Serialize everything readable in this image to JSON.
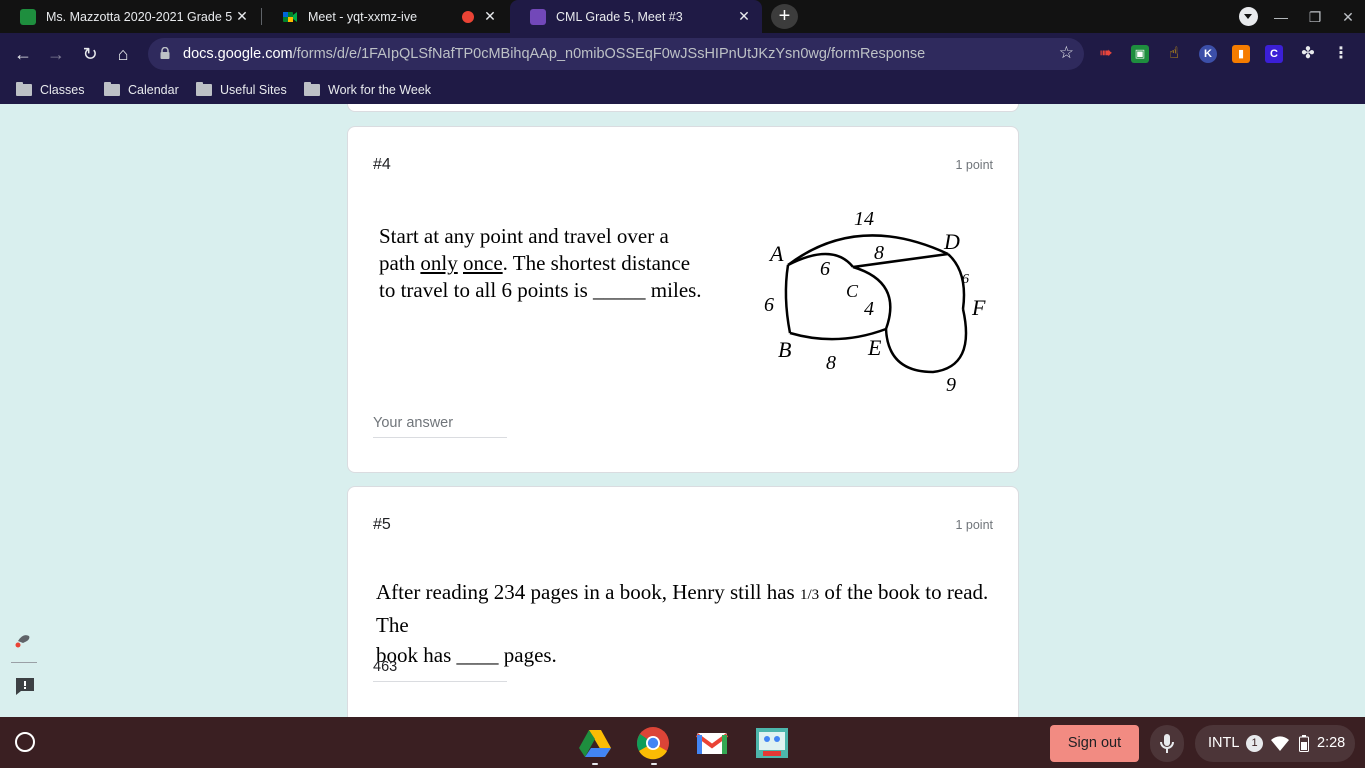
{
  "tabs": [
    {
      "title": "Ms. Mazzotta 2020-2021 Grade 5",
      "favicon": "classroom-icon",
      "color": "#1e8e3e"
    },
    {
      "title": "Meet - yqt-xxmz-ive",
      "favicon": "meet-icon",
      "recording": true
    },
    {
      "title": "CML Grade 5, Meet #3",
      "favicon": "forms-icon",
      "color": "#7248b9",
      "active": true
    }
  ],
  "address_bar": {
    "host": "docs.google.com",
    "path": "/forms/d/e/1FAIpQLSfNafTP0cMBihqAAp_n0mibOSSEqF0wJSsHIPnUtJKzYsn0wg/formResponse"
  },
  "bookmarks": [
    "Classes",
    "Calendar",
    "Useful Sites",
    "Work for the Week"
  ],
  "questions": [
    {
      "number": "#4",
      "points": "1 point",
      "text_lines": [
        "Start at any point and travel over a",
        "path",
        "only",
        "once",
        ".  The shortest distance",
        "to travel to all 6 points is _____ miles."
      ],
      "answer_placeholder": "Your answer",
      "figure": {
        "vertices": [
          "A",
          "B",
          "C",
          "D",
          "E",
          "F"
        ],
        "edge_labels": [
          "14",
          "8",
          "6",
          "6",
          "4",
          "8",
          "9",
          "6"
        ]
      }
    },
    {
      "number": "#5",
      "points": "1 point",
      "text_line1": "After reading 234 pages in a book, Henry still has",
      "fraction": "1/3",
      "text_line1_end": "of the book to read. The",
      "text_line2": "book has ____ pages.",
      "answer_value": "463"
    }
  ],
  "shelf": {
    "apps": [
      "drive-icon",
      "chrome-icon",
      "gmail-icon",
      "classroom-app-icon"
    ],
    "sign_out": "Sign out",
    "ime": "INTL",
    "notification_count": "1",
    "time": "2:28"
  }
}
